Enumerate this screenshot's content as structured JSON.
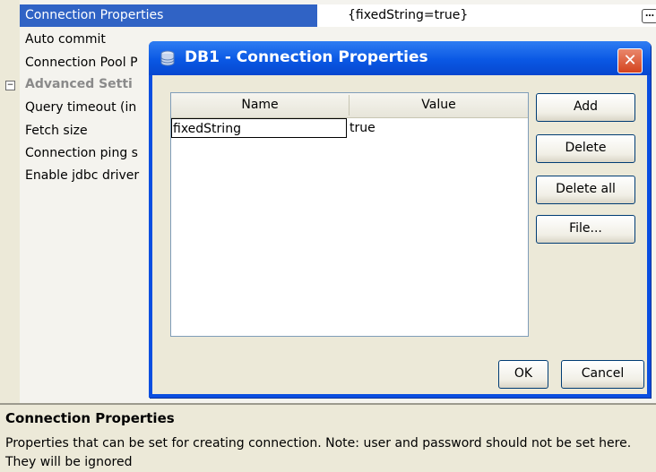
{
  "properties": [
    {
      "name": "Connection Properties",
      "value": "{fixedString=true}",
      "selected": true
    },
    {
      "name": "Auto commit",
      "value": ""
    },
    {
      "name": "Connection Pool P",
      "value": ""
    },
    {
      "name": "Advanced Setti",
      "value": "",
      "category": true
    },
    {
      "name": "Query timeout (in",
      "value": ""
    },
    {
      "name": "Fetch size",
      "value": ""
    },
    {
      "name": "Connection ping s",
      "value": ""
    },
    {
      "name": "Enable jdbc driver",
      "value": ""
    }
  ],
  "ellipsis_label": "…",
  "collapse_symbol": "−",
  "description": {
    "title": "Connection Properties",
    "text": "Properties that can be set for creating connection. Note: user and password should not be set here. They will be ignored"
  },
  "dialog": {
    "title": "DB1 - Connection Properties",
    "close_label": "✕",
    "columns": {
      "name": "Name",
      "value": "Value"
    },
    "rows": [
      {
        "name": "fixedString",
        "value": "true"
      }
    ],
    "buttons": {
      "add": "Add",
      "delete": "Delete",
      "delete_all": "Delete all",
      "file": "File...",
      "ok": "OK",
      "cancel": "Cancel"
    }
  },
  "colors": {
    "selection": "#3063c5",
    "titlebar": "#0a58e4",
    "close": "#d4431e"
  }
}
